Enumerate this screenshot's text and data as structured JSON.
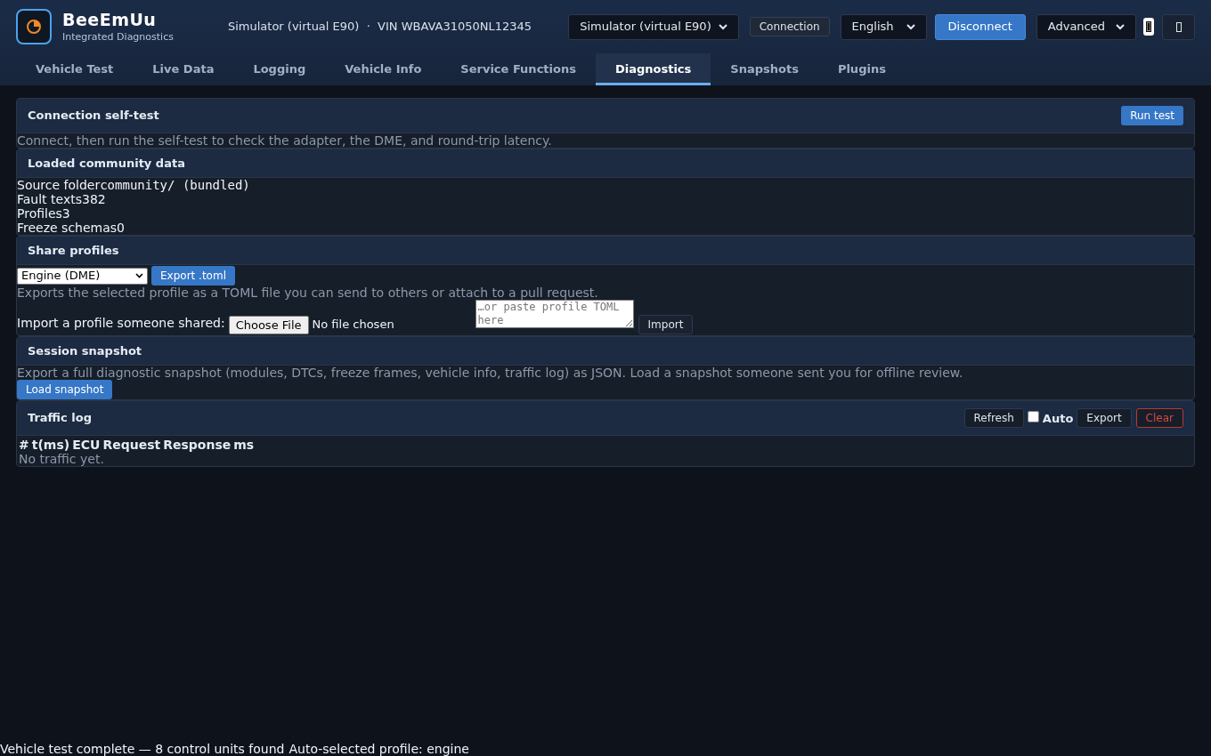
{
  "app": {
    "name": "BeeEmUu",
    "subtitle": "Integrated Diagnostics",
    "connection_info": "Simulator (virtual E90)  ·  VIN WBAVA31050NL12345"
  },
  "toolbar": {
    "adapter_select": "Simulator (virtual E90)",
    "connection_button": "Connection",
    "language_select": "English",
    "disconnect_button": "Disconnect",
    "mode_select": "Advanced"
  },
  "tabs": [
    {
      "label": "Vehicle Test",
      "selected": false
    },
    {
      "label": "Live Data",
      "selected": false
    },
    {
      "label": "Logging",
      "selected": false
    },
    {
      "label": "Vehicle Info",
      "selected": false
    },
    {
      "label": "Service Functions",
      "selected": false
    },
    {
      "label": "Diagnostics",
      "selected": true
    },
    {
      "label": "Snapshots",
      "selected": false
    },
    {
      "label": "Plugins",
      "selected": false
    }
  ],
  "self_test": {
    "title": "Connection self-test",
    "button": "Run test",
    "hint": "Connect, then run the self-test to check the adapter, the DME, and round-trip latency."
  },
  "community_data": {
    "title": "Loaded community data",
    "rows": [
      {
        "label": "Source folder",
        "value": "community/ (bundled)",
        "kind": "mono"
      },
      {
        "label": "Fault texts",
        "value": "382",
        "kind": "plain"
      },
      {
        "label": "Profiles",
        "value": "3",
        "kind": "plain"
      },
      {
        "label": "Freeze schemas",
        "value": "0",
        "kind": "plain"
      }
    ]
  },
  "share_profiles": {
    "title": "Share profiles",
    "profile_select": "Engine (DME)",
    "export_button": "Export .toml",
    "hint": "Exports the selected profile as a TOML file you can send to others or attach to a pull request.",
    "import_label": "Import a profile someone shared:",
    "file_button": "Choose File",
    "file_status": "No file chosen",
    "paste_placeholder": "…or paste profile TOML here",
    "import_button": "Import"
  },
  "session_snapshot": {
    "title": "Session snapshot",
    "hint": "Export a full diagnostic snapshot (modules, DTCs, freeze frames, vehicle info, traffic log) as JSON. Load a snapshot someone sent you for offline review.",
    "load_button": "Load snapshot"
  },
  "traffic_log": {
    "title": "Traffic log",
    "refresh_button": "Refresh",
    "auto": {
      "label": "Auto",
      "checked": false
    },
    "export_button": "Export",
    "clear_button": "Clear",
    "columns": [
      "#",
      "t(ms)",
      "ECU",
      "Request",
      "Response",
      "ms"
    ],
    "empty": "No traffic yet."
  },
  "status_bar": {
    "messages": [
      "Vehicle test complete — 8 control units found",
      "Auto-selected profile: engine"
    ]
  }
}
